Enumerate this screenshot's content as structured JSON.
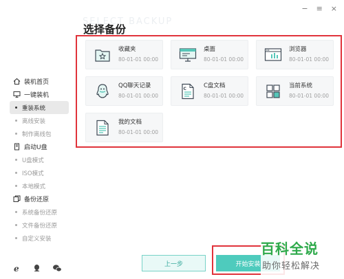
{
  "window": {
    "minimize_glyph": "−",
    "maximize_glyph": "≡",
    "close_glyph": "×"
  },
  "ghost_title": "SELECT BACKUP",
  "title": "选择备份",
  "sidebar": {
    "home": "装机首页",
    "one_click": "一键装机",
    "one_click_items": [
      "重装系统",
      "离线安装",
      "制作离线包"
    ],
    "usb": "启动U盘",
    "usb_items": [
      "U盘模式",
      "ISO模式",
      "本地模式"
    ],
    "backup": "备份还原",
    "backup_items": [
      "系统备份还原",
      "文件备份还原",
      "自定义安装"
    ],
    "bottom_icons": [
      "ie-icon",
      "qq-icon",
      "wechat-icon"
    ]
  },
  "cards": [
    {
      "name": "收藏夹",
      "date": "80-01-01 00:00",
      "icon": "favorites-icon"
    },
    {
      "name": "桌面",
      "date": "80-01-01 00:00",
      "icon": "desktop-icon"
    },
    {
      "name": "浏览器",
      "date": "80-01-01 00:00",
      "icon": "browser-icon"
    },
    {
      "name": "QQ聊天记录",
      "date": "80-01-01 00:00",
      "icon": "qq-icon"
    },
    {
      "name": "C盘文档",
      "date": "80-01-01 00:00",
      "icon": "document-icon"
    },
    {
      "name": "当前系统",
      "date": "80-01-01 00:00",
      "icon": "system-icon"
    },
    {
      "name": "我的文档",
      "date": "80-01-01 00:00",
      "icon": "my-documents-icon"
    }
  ],
  "buttons": {
    "prev": "上一步",
    "start": "开始安装"
  },
  "watermark": {
    "line1": "百科全说",
    "line2": "助你轻松解决"
  },
  "colors": {
    "accent": "#4ecbbd",
    "highlight_frame": "#e0323a",
    "brand_green": "#2faa4b"
  }
}
